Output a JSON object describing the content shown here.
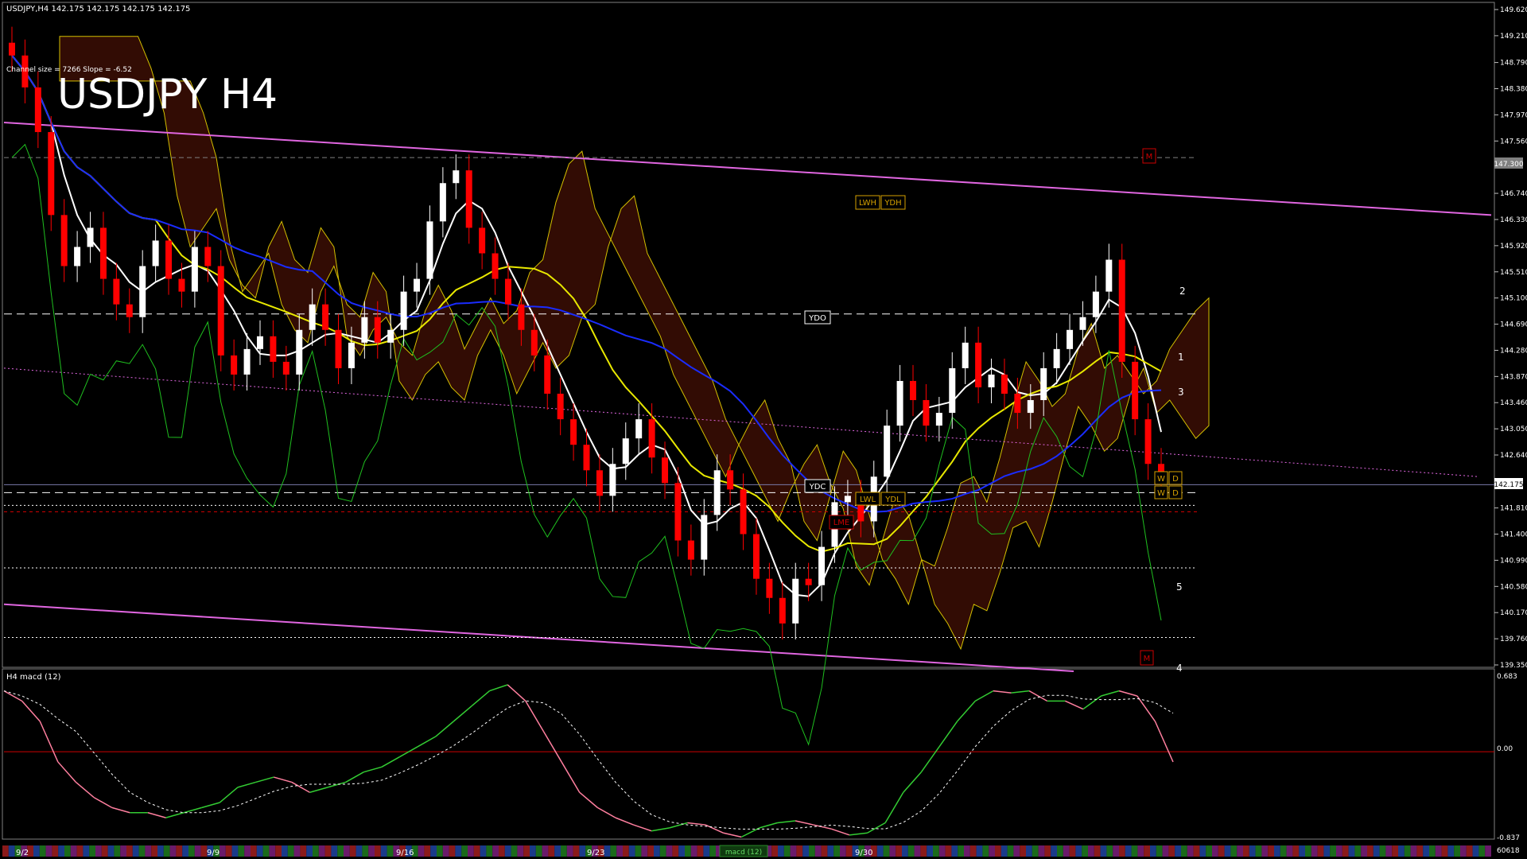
{
  "header": {
    "symbol_line": "USDJPY,H4  142.175 142.175 142.175 142.175",
    "channel_info": "Channel size = 7266 Slope = -6.52",
    "big_title": "USDJPY H4"
  },
  "colors": {
    "background": "#000000",
    "axis": "#c0c0c0",
    "bull_candle": "#ffffff",
    "bear_candle": "#ff0000",
    "ma_white": "#ffffff",
    "ma_yellow": "#e8e800",
    "ma_blue": "#1a2cff",
    "channel": "#e066e0",
    "green_line": "#1fbf1f",
    "red_bands": "#c00000",
    "cloud_bull": "#3a7ad0",
    "cloud_bear": "#c83010",
    "macd_pos": "#33cc33",
    "macd_neg": "#ff7f9f",
    "macd_zero": "#cc0000"
  },
  "level_labels": {
    "ydo": "YDO",
    "ydc": "YDC",
    "lwh": "LWH",
    "ydh": "YDH",
    "lwl": "LWL",
    "ydl": "YDL",
    "lme": "LME",
    "m_top": "M",
    "m_bottom": "M",
    "w": "W",
    "d": "D"
  },
  "wave_labels": [
    "2",
    "1",
    "3",
    "5",
    "4"
  ],
  "price_tag": "142.175",
  "marker_price_tag": "147.300",
  "macd_panel": {
    "title": "H4  macd (12)",
    "axis": [
      "0.683",
      "0.00",
      "-0.837"
    ],
    "bottom_right": "60618"
  },
  "time_axis": {
    "labels": [
      "9/2",
      "9/9",
      "9/16",
      "9/23",
      "9/30"
    ],
    "tab_label": "macd (12)"
  },
  "chart_data": {
    "type": "line",
    "title": "USDJPY H4",
    "instrument": "USDJPY",
    "timeframe": "H4",
    "ylim": [
      139.35,
      149.62
    ],
    "y_ticks": [
      149.62,
      149.21,
      148.79,
      148.38,
      147.97,
      147.56,
      146.74,
      146.33,
      145.92,
      145.51,
      145.1,
      144.69,
      144.28,
      143.87,
      143.46,
      143.05,
      142.64,
      141.81,
      141.4,
      140.99,
      140.58,
      140.17,
      139.76,
      139.35
    ],
    "current_price": 142.175,
    "x_ticks": [
      "9/2",
      "9/9",
      "9/16",
      "9/23",
      "9/30"
    ],
    "series": [
      {
        "name": "USDJPY",
        "values": [
          148.9,
          148.4,
          147.7,
          146.4,
          145.6,
          145.9,
          146.2,
          145.4,
          145.0,
          144.8,
          145.6,
          146.0,
          145.4,
          145.2,
          145.9,
          145.6,
          144.2,
          143.9,
          144.3,
          144.5,
          144.1,
          143.9,
          144.6,
          145.0,
          144.6,
          144.0,
          144.4,
          144.8,
          144.4,
          144.6,
          145.2,
          145.4,
          146.3,
          146.9,
          147.1,
          146.2,
          145.8,
          145.4,
          145.0,
          144.6,
          144.2,
          143.6,
          143.2,
          142.8,
          142.4,
          142.0,
          142.5,
          142.9,
          143.2,
          142.6,
          142.2,
          141.3,
          141.0,
          141.7,
          142.4,
          142.1,
          141.4,
          140.7,
          140.4,
          140.0,
          140.7,
          140.6,
          141.2,
          141.9,
          142.0,
          141.6,
          142.3,
          143.1,
          143.8,
          143.5,
          143.1,
          143.3,
          144.0,
          144.4,
          143.7,
          143.9,
          143.6,
          143.3,
          143.5,
          144.0,
          144.3,
          144.6,
          144.8,
          145.2,
          145.7,
          144.1,
          143.2,
          142.5,
          142.2
        ]
      }
    ],
    "macd": {
      "ylim": [
        -0.837,
        0.683
      ],
      "values": [
        0.6,
        0.5,
        0.3,
        -0.1,
        -0.3,
        -0.45,
        -0.55,
        -0.6,
        -0.6,
        -0.65,
        -0.6,
        -0.55,
        -0.5,
        -0.35,
        -0.3,
        -0.25,
        -0.3,
        -0.4,
        -0.35,
        -0.3,
        -0.2,
        -0.15,
        -0.05,
        0.05,
        0.15,
        0.3,
        0.45,
        0.6,
        0.66,
        0.5,
        0.2,
        -0.1,
        -0.4,
        -0.55,
        -0.65,
        -0.72,
        -0.78,
        -0.75,
        -0.7,
        -0.72,
        -0.8,
        -0.84,
        -0.75,
        -0.7,
        -0.68,
        -0.72,
        -0.76,
        -0.82,
        -0.8,
        -0.7,
        -0.4,
        -0.2,
        0.05,
        0.3,
        0.5,
        0.6,
        0.58,
        0.6,
        0.5,
        0.5,
        0.42,
        0.55,
        0.6,
        0.55,
        0.3,
        -0.1
      ]
    }
  }
}
